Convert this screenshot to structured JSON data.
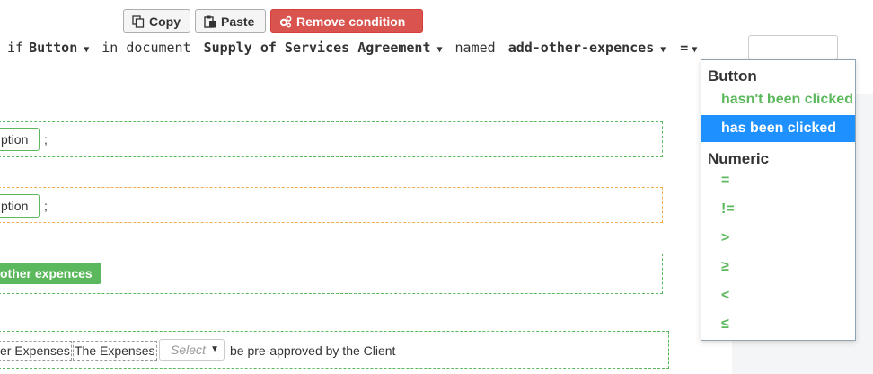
{
  "toolbar": {
    "copy_label": "Copy",
    "paste_label": "Paste",
    "remove_label": "Remove condition"
  },
  "condition": {
    "if_label": "if",
    "element_type": "Button",
    "in_document_label": "in document",
    "document_name": "Supply of Services Agreement",
    "named_label": "named",
    "element_name": "add-other-expences",
    "operator": "=",
    "value_input": ""
  },
  "clauses": {
    "row1_chip": "ption",
    "row1_semicolon": ";",
    "row2_chip": "ption",
    "row2_semicolon": ";",
    "row3_button": "other expences",
    "row4_chip1": "er Expenses",
    "row4_chip2": "The Expenses",
    "row4_select_placeholder": "Select",
    "row4_text": "be pre-approved by the Client"
  },
  "dropdown": {
    "groups": [
      {
        "label": "Button",
        "options": [
          "hasn't been clicked",
          "has been clicked"
        ]
      },
      {
        "label": "Numeric",
        "options": [
          "=",
          "!=",
          ">",
          "≥",
          "<",
          "≤"
        ]
      }
    ],
    "selected": "has been clicked"
  },
  "colors": {
    "remove_button": "#d9534f",
    "selected_option": "#1e90ff",
    "option_text": "#5cb85c",
    "clause_border": "#5cb85c",
    "warning_border": "#f0ad4e"
  }
}
